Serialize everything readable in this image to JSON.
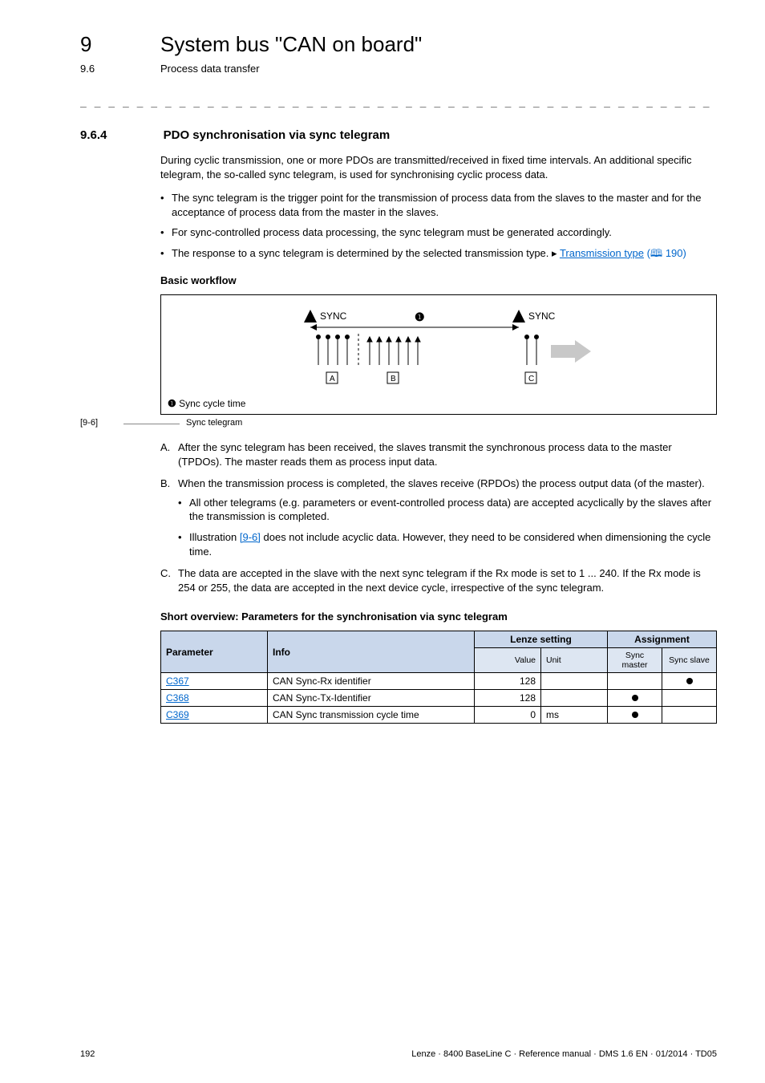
{
  "chapter": {
    "num": "9",
    "title": "System bus \"CAN on board\""
  },
  "section": {
    "num": "9.6",
    "title": "Process data transfer"
  },
  "dashline": "_ _ _ _ _ _ _ _ _ _ _ _ _ _ _ _ _ _ _ _ _ _ _ _ _ _ _ _ _ _ _ _ _ _ _ _ _ _ _ _ _ _ _ _ _ _ _ _ _ _ _ _ _ _ _ _ _ _ _ _ _ _ _ _",
  "subsection": {
    "num": "9.6.4",
    "title": "PDO synchronisation via sync telegram"
  },
  "intro": "During cyclic transmission, one or more PDOs are transmitted/received in fixed time intervals. An additional specific telegram, the so-called sync telegram, is used for synchronising cyclic process data.",
  "bullets": [
    "The sync telegram is the trigger point for the transmission of process data from the slaves to the master and for the acceptance of process data from the master in the slaves.",
    "For sync-controlled process data processing, the sync telegram must be generated accordingly."
  ],
  "bullet3_prefix": "The response to a sync telegram is determined by the selected transmission type. ",
  "bullet3_arrow": "▸",
  "bullet3_link": "Transmission type",
  "bullet3_pageref": "(🕮 190)",
  "workflow_heading": "Basic workflow",
  "diagram": {
    "sync_label": "SYNC",
    "box_a": "A",
    "box_b": "B",
    "box_c": "C",
    "circ_one": "❶",
    "legend_one": "❶",
    "legend_text": "Sync cycle time"
  },
  "caption": {
    "tag": "[9-6]",
    "text": "Sync telegram"
  },
  "alpha": {
    "a_marker": "A.",
    "a_text": "After the sync telegram has been received, the slaves transmit the synchronous process data to the master (TPDOs). The master reads them as process input data.",
    "b_marker": "B.",
    "b_text": "When the transmission process is completed, the slaves receive (RPDOs) the process output data (of the master).",
    "b_sub1": "All other telegrams (e.g. parameters or event-controlled process data) are accepted acyclically by the slaves after the transmission is completed.",
    "b_sub2_prefix": "Illustration ",
    "b_sub2_link": "[9-6]",
    "b_sub2_suffix": " does not include acyclic data. However, they need to be considered when dimensioning the cycle time.",
    "c_marker": "C.",
    "c_text": "The data are accepted in the slave with the next sync telegram if the Rx mode is set to 1 ... 240. If the Rx mode is 254 or 255, the data are accepted in the next device cycle, irrespective of the sync telegram."
  },
  "table_heading": "Short overview: Parameters for the synchronisation via sync telegram",
  "table": {
    "head": {
      "param": "Parameter",
      "info": "Info",
      "lenze": "Lenze setting",
      "assign": "Assignment",
      "value": "Value",
      "unit": "Unit",
      "sync_master": "Sync master",
      "sync_slave": "Sync slave"
    },
    "rows": [
      {
        "param": "C367",
        "info": "CAN Sync-Rx identifier",
        "value": "128",
        "unit": "",
        "master": false,
        "slave": true
      },
      {
        "param": "C368",
        "info": "CAN Sync-Tx-Identifier",
        "value": "128",
        "unit": "",
        "master": true,
        "slave": false
      },
      {
        "param": "C369",
        "info": "CAN Sync transmission cycle time",
        "value": "0",
        "unit": "ms",
        "master": true,
        "slave": false
      }
    ]
  },
  "footer": {
    "page": "192",
    "copyright": "Lenze · 8400 BaseLine C · Reference manual · DMS 1.6 EN · 01/2014 · TD05"
  }
}
